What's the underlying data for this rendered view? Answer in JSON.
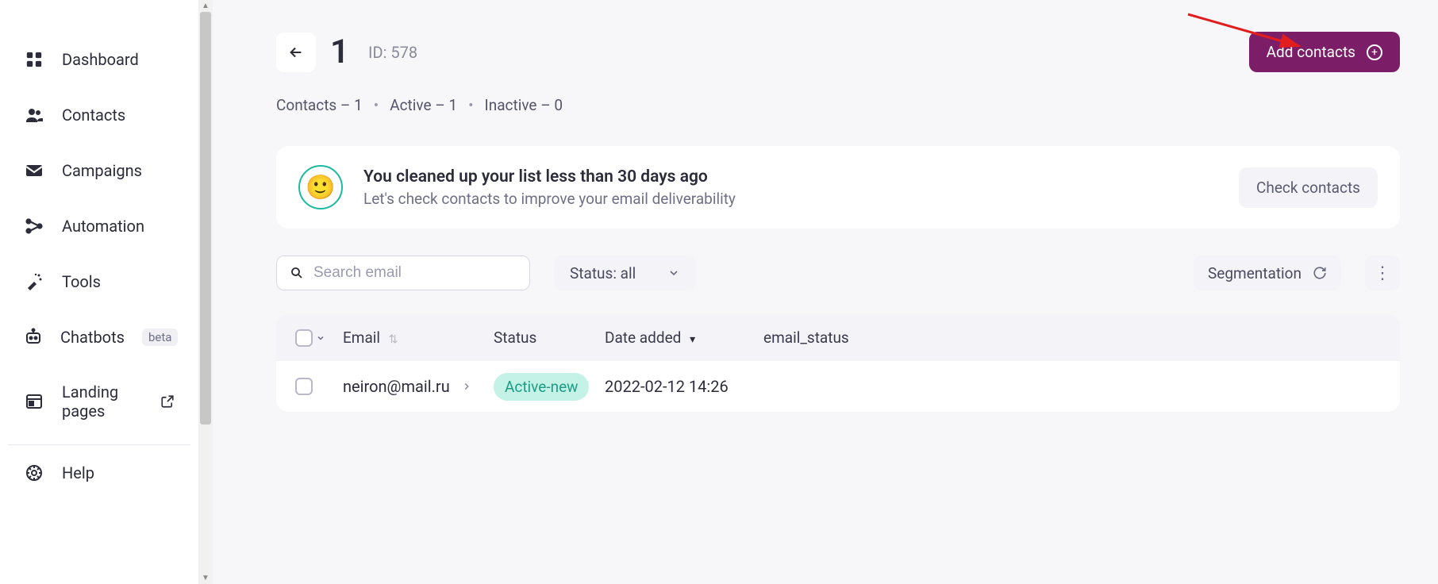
{
  "sidebar": {
    "items": [
      {
        "label": "Dashboard"
      },
      {
        "label": "Contacts"
      },
      {
        "label": "Campaigns"
      },
      {
        "label": "Automation"
      },
      {
        "label": "Tools"
      },
      {
        "label": "Chatbots",
        "badge": "beta"
      },
      {
        "label": "Landing pages"
      }
    ],
    "help_label": "Help"
  },
  "header": {
    "title": "1",
    "id_label": "ID: 578",
    "add_contacts_label": "Add contacts"
  },
  "stats": {
    "contacts": "Contacts – 1",
    "active": "Active – 1",
    "inactive": "Inactive – 0"
  },
  "notice": {
    "title": "You cleaned up your list less than 30 days ago",
    "subtitle": "Let's check contacts to improve your email deliverability",
    "button": "Check contacts"
  },
  "controls": {
    "search_placeholder": "Search email",
    "status_label": "Status: all",
    "segmentation_label": "Segmentation"
  },
  "table": {
    "headers": {
      "email": "Email",
      "status": "Status",
      "date_added": "Date added",
      "email_status": "email_status"
    },
    "rows": [
      {
        "email": "neiron@mail.ru",
        "status": "Active-new",
        "date_added": "2022-02-12 14:26",
        "email_status": ""
      }
    ]
  }
}
